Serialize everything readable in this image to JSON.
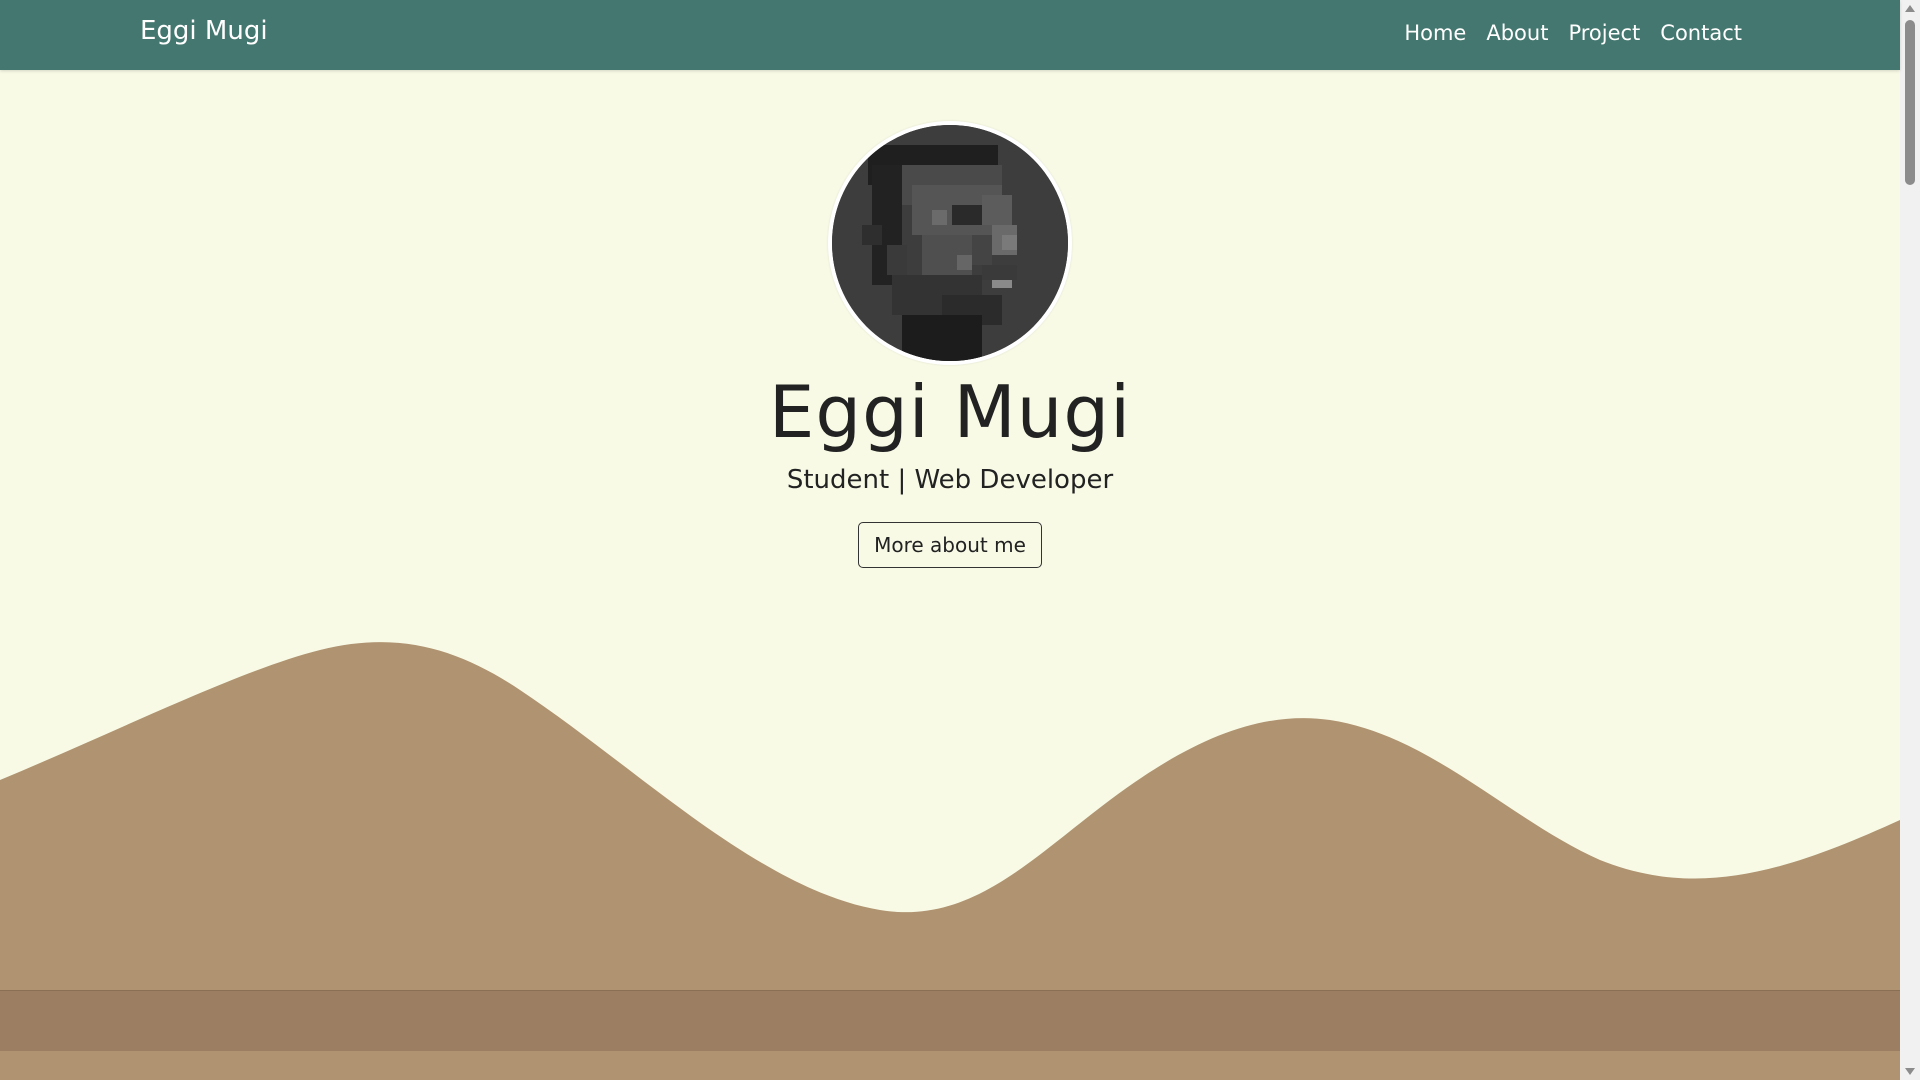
{
  "navbar": {
    "brand": "Eggi Mugi",
    "links": [
      {
        "label": "Home"
      },
      {
        "label": "About"
      },
      {
        "label": "Project"
      },
      {
        "label": "Contact"
      }
    ]
  },
  "hero": {
    "name": "Eggi Mugi",
    "role": "Student | Web Developer",
    "cta_label": "More about me"
  },
  "colors": {
    "navbar_bg": "#44776F",
    "page_bg": "#F8FAE6",
    "wave": "#B09370",
    "strip": "#9C7F62"
  }
}
